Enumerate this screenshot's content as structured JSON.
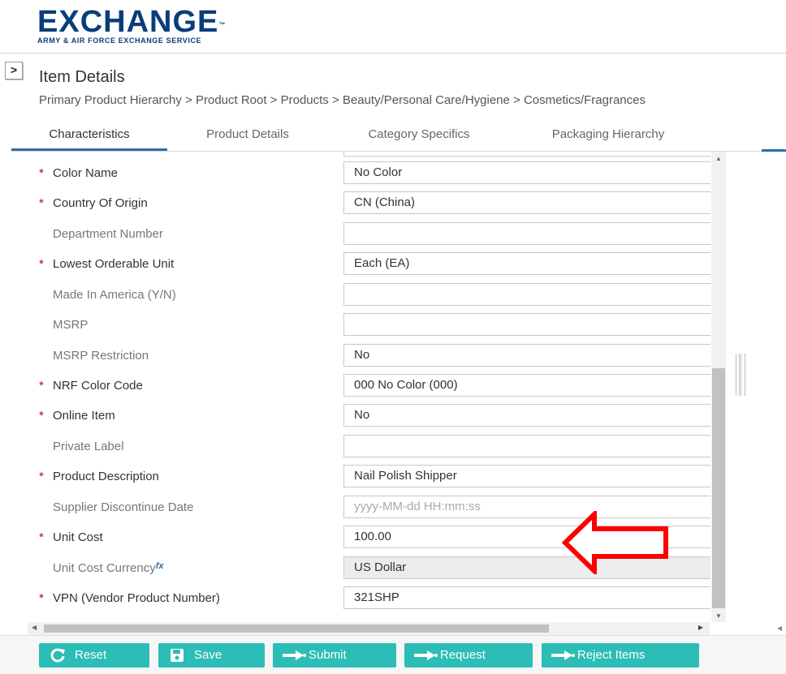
{
  "header": {
    "logo_main": "EXCHANGE",
    "logo_tm": "™",
    "logo_sub": "ARMY & AIR FORCE EXCHANGE SERVICE"
  },
  "sidebar_toggle": ">",
  "page": {
    "title": "Item Details",
    "breadcrumb": "Primary Product Hierarchy > Product Root > Products > Beauty/Personal Care/Hygiene > Cosmetics/Fragrances"
  },
  "tabs": [
    {
      "label": "Characteristics",
      "active": true
    },
    {
      "label": "Product Details",
      "active": false
    },
    {
      "label": "Category Specifics",
      "active": false
    },
    {
      "label": "Packaging Hierarchy",
      "active": false
    }
  ],
  "fields": [
    {
      "label": "Color Name",
      "required": true,
      "value": "No Color",
      "placeholder": ""
    },
    {
      "label": "Country Of Origin",
      "required": true,
      "value": "CN (China)",
      "placeholder": ""
    },
    {
      "label": "Department Number",
      "required": false,
      "value": "",
      "placeholder": ""
    },
    {
      "label": "Lowest Orderable Unit",
      "required": true,
      "value": "Each (EA)",
      "placeholder": ""
    },
    {
      "label": "Made In America (Y/N)",
      "required": false,
      "value": "",
      "placeholder": ""
    },
    {
      "label": "MSRP",
      "required": false,
      "value": "",
      "placeholder": ""
    },
    {
      "label": "MSRP Restriction",
      "required": false,
      "value": "No",
      "placeholder": ""
    },
    {
      "label": "NRF Color Code",
      "required": true,
      "value": "000 No Color (000)",
      "placeholder": ""
    },
    {
      "label": "Online Item",
      "required": true,
      "value": "No",
      "placeholder": ""
    },
    {
      "label": "Private Label",
      "required": false,
      "value": "",
      "placeholder": ""
    },
    {
      "label": "Product Description",
      "required": true,
      "value": "Nail Polish Shipper",
      "placeholder": ""
    },
    {
      "label": "Supplier Discontinue Date",
      "required": false,
      "value": "",
      "placeholder": "yyyy-MM-dd HH:mm:ss"
    },
    {
      "label": "Unit Cost",
      "required": true,
      "value": "100.00",
      "placeholder": ""
    },
    {
      "label": "Unit Cost Currency",
      "required": false,
      "value": "US Dollar",
      "placeholder": "",
      "formula_icon": "fx",
      "readonly": true
    },
    {
      "label": "VPN (Vendor Product Number)",
      "required": true,
      "value": "321SHP",
      "placeholder": ""
    }
  ],
  "required_marker": "*",
  "buttons": [
    {
      "label": "Reset",
      "icon": "refresh-icon"
    },
    {
      "label": "Save",
      "icon": "save-icon"
    },
    {
      "label": "Submit",
      "icon": "arrow-right-icon"
    },
    {
      "label": "Request",
      "icon": "arrow-right-icon"
    },
    {
      "label": "Reject Items",
      "icon": "arrow-right-icon"
    }
  ],
  "colors": {
    "brand": "#0a3d7a",
    "tab_accent": "#2a6fa8",
    "button": "#2bbdb6",
    "required": "#cc0000",
    "annotation_arrow": "#ff0000"
  }
}
